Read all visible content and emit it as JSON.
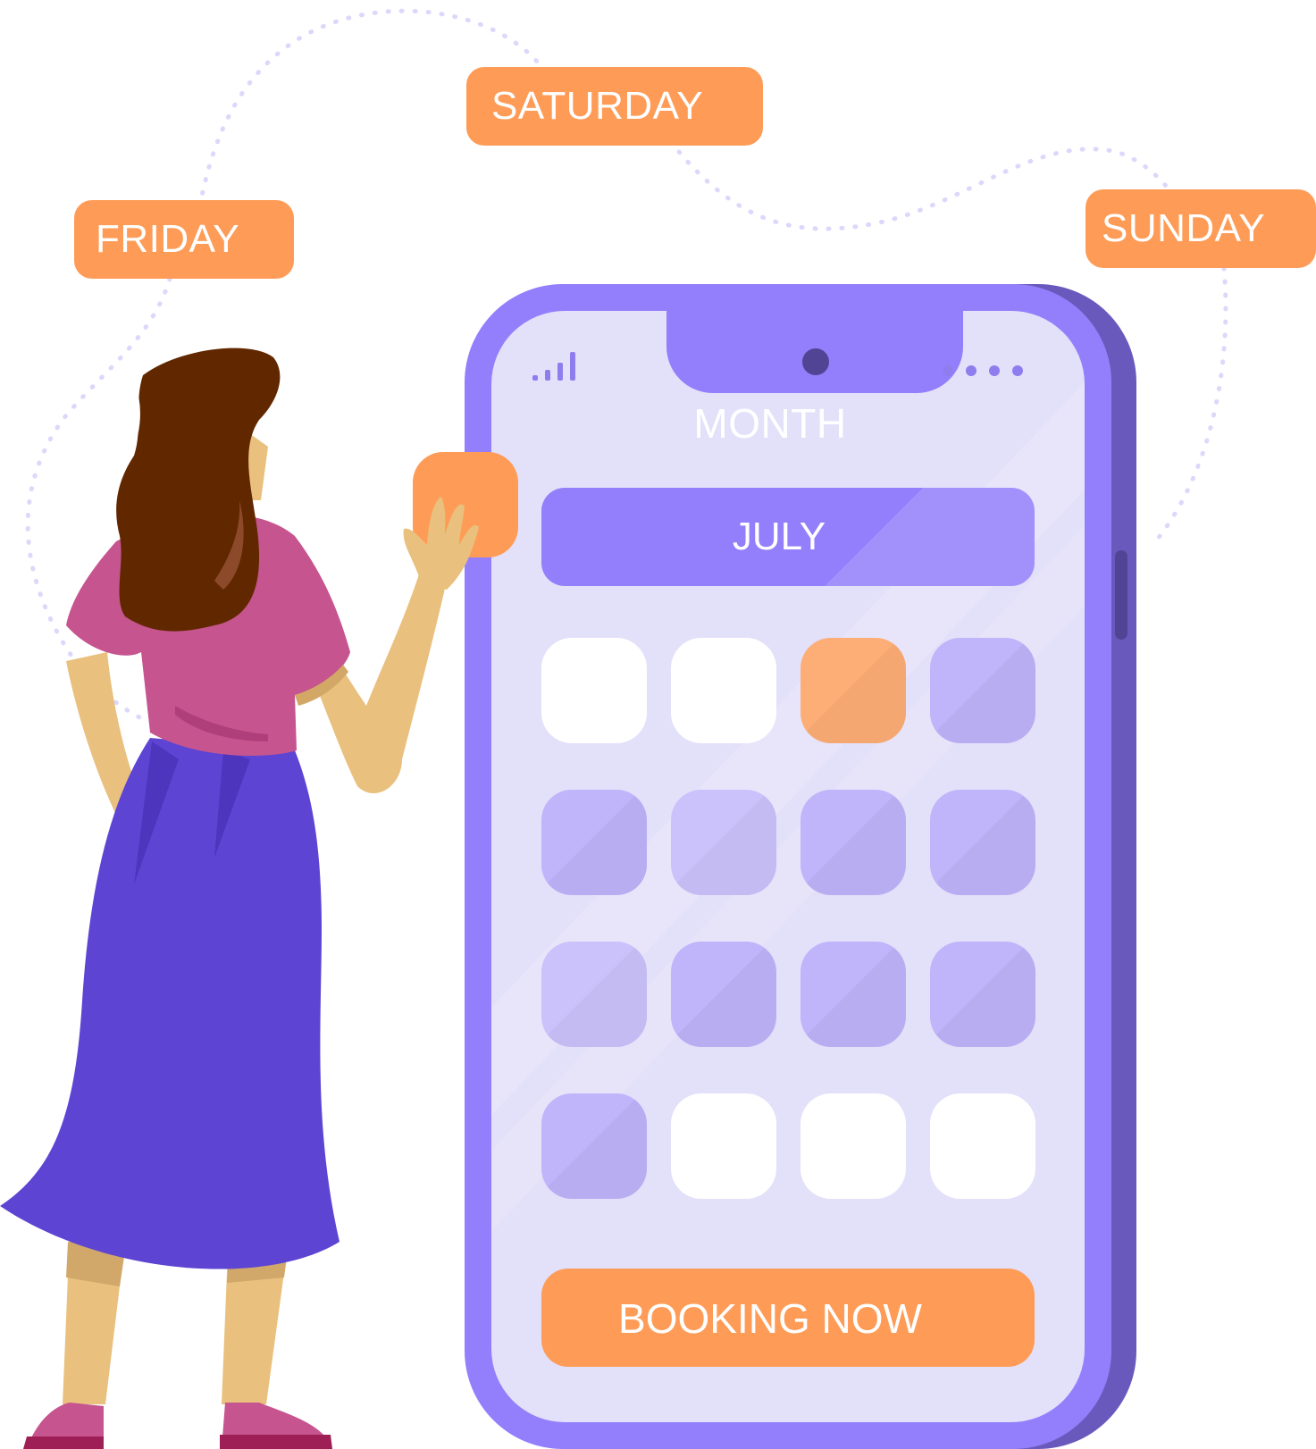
{
  "tags": {
    "friday": "FRIDAY",
    "saturday": "SATURDAY",
    "sunday": "SUNDAY"
  },
  "phone": {
    "month_label": "MONTH",
    "month_value": "JULY",
    "booking_label": "BOOKING NOW",
    "calendar_cells": [
      "white",
      "white",
      "orange",
      "mid",
      "mid",
      "light",
      "mid",
      "mid",
      "light",
      "mid",
      "mid",
      "mid",
      "mid",
      "white",
      "white",
      "white"
    ],
    "selected_cell_index": 2
  },
  "colors": {
    "accent_orange": "#fe9c57",
    "phone_purple": "#937ffb",
    "phone_shadow": "#6a59bd",
    "screen": "#e3e0fa",
    "skirt": "#5d44d3",
    "top": "#c6548f",
    "hair": "#612800",
    "skin": "#e9c07d"
  },
  "icons": [
    "signal-icon",
    "more-dots-icon",
    "camera-icon"
  ]
}
